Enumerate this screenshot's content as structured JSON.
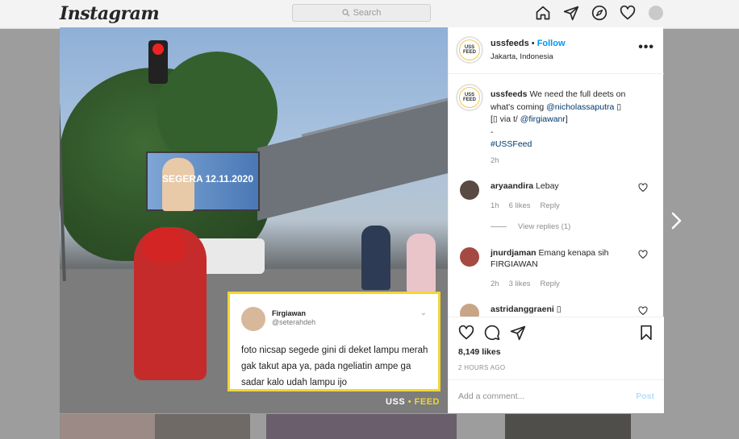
{
  "nav": {
    "logo": "Instagram",
    "search_placeholder": "Search",
    "icons": [
      "home-icon",
      "direct-icon",
      "explore-icon",
      "activity-heart-icon",
      "profile-avatar"
    ]
  },
  "post": {
    "header": {
      "username": "ussfeeds",
      "separator": "•",
      "follow_label": "Follow",
      "location": "Jakarta, Indonesia",
      "more_label": "•••",
      "avatar_text": "USS FEED"
    },
    "image": {
      "billboard_text": "SEGERA 12.11.2020",
      "tweet": {
        "name": "Firgiawan",
        "handle": "@seterahdeh",
        "body": "foto nicsap segede gini di deket lampu merah gak takut apa ya, pada ngeliatin ampe ga sadar kalo udah lampu ijo"
      },
      "watermark_left": "USS",
      "watermark_sep": "•",
      "watermark_right": "FEED"
    },
    "caption": {
      "username": "ussfeeds",
      "text_1": "We need the full deets on what's coming",
      "mention_1": "@nicholassaputra",
      "emoji_1": "▯",
      "text_2": "[▯ via t/",
      "mention_2": "@firgiawanr",
      "text_3": "]",
      "dash": "-",
      "hashtag": "#USSFeed",
      "time": "2h"
    },
    "comments": [
      {
        "username": "aryaandira",
        "text": "Lebay",
        "time": "1h",
        "likes": "6 likes",
        "reply": "Reply",
        "view_replies": "View replies (1)"
      },
      {
        "username": "jnurdjaman",
        "text": "Emang kenapa sih FIRGIAWAN",
        "time": "2h",
        "likes": "3 likes",
        "reply": "Reply"
      },
      {
        "username": "astridanggraeni",
        "text": "▯"
      }
    ],
    "likes": "8,149 likes",
    "date": "2 HOURS AGO",
    "add_comment_placeholder": "Add a comment...",
    "post_label": "Post"
  },
  "colors": {
    "accent": "#0095f6",
    "link": "#00376b",
    "tweet_border": "#f2d535"
  }
}
